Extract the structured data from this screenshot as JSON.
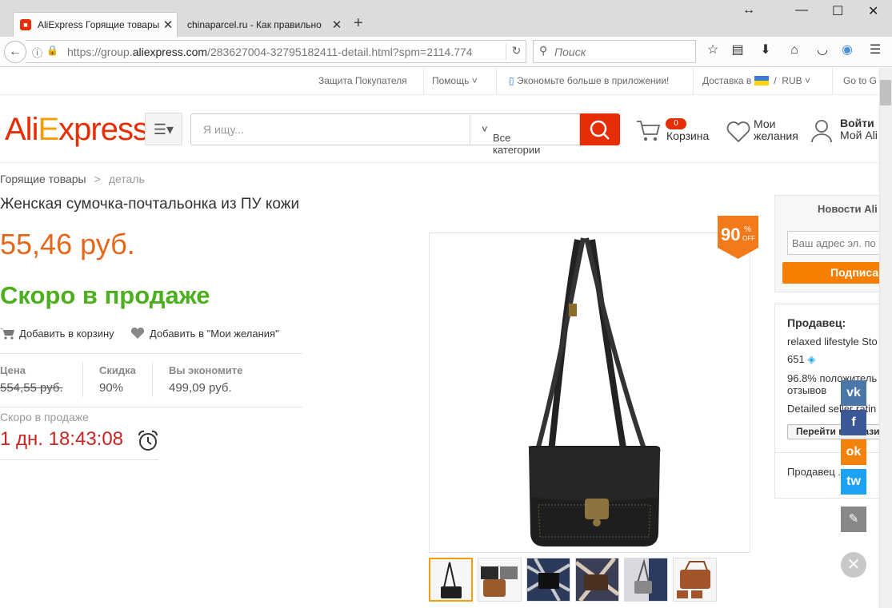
{
  "browser": {
    "tabs": [
      {
        "title": "AliExpress Горящие товары",
        "favicon": "aliexpress-favicon"
      },
      {
        "title": "chinaparcel.ru - Как правильно",
        "favicon": "none"
      }
    ],
    "url_prefix": "https://group.",
    "url_domain": "aliexpress.com",
    "url_rest": "/283627004-32795182411-detail.html?spm=2114.774",
    "search_placeholder": "Поиск"
  },
  "topbar": {
    "buyer_protection": "Защита Покупателя",
    "help": "Помощь",
    "app_promo": "Экономьте больше в приложении!",
    "ship_to": "Доставка в",
    "currency_sep": "/",
    "currency": "RUB",
    "go_to": "Go to G"
  },
  "header": {
    "logo": {
      "part1": "Ali",
      "part2": "E",
      "part3": "xpress",
      "tm": "™"
    },
    "search_placeholder": "Я ищу...",
    "category": "Все категории",
    "cart_count": "0",
    "cart_label": "Корзина",
    "wishlist_line1": "Мои",
    "wishlist_line2": "желания",
    "login_line1": "Войти",
    "login_line2": "Мой Ali"
  },
  "breadcrumb": {
    "home": "Горящие товары",
    "sep": ">",
    "current": "деталь"
  },
  "product": {
    "title": "Женская сумочка-почтальонка из ПУ кожи",
    "price": "55,46 руб.",
    "status": "Скоро в продаже",
    "add_to_cart": "Добавить в корзину",
    "add_to_wishlist": "Добавить в \"Мои желания\"",
    "price_label": "Цена",
    "price_old": "554,55 руб.",
    "discount_label": "Скидка",
    "discount_value": "90%",
    "save_label": "Вы экономите",
    "save_value": "499,09 руб.",
    "soon_label": "Скоро в продаже",
    "countdown": "1 дн. 18:43:08",
    "badge_number": "90",
    "badge_percent": "%",
    "badge_off": "OFF",
    "thumbnails": 6
  },
  "sidebar": {
    "news_title": "Новости Ali",
    "email_placeholder": "Ваш адрес эл. по",
    "subscribe": "Подписа",
    "seller_title": "Продавец:",
    "store_name": "relaxed lifestyle Sto",
    "store_score": "651",
    "feedback_line1": "96.8% положитель",
    "feedback_line2": "отзывов",
    "detailed": "Detailed seller ratin",
    "contact": "Перейти в магази",
    "seller_items": "Продавец ..."
  },
  "social": {
    "vk": "vk",
    "fb": "f",
    "ok": "ok",
    "tw": "tw"
  },
  "colors": {
    "brand": "#e62e04",
    "price": "#e4671a",
    "soon": "#4caf1e",
    "timer": "#cc2222"
  }
}
